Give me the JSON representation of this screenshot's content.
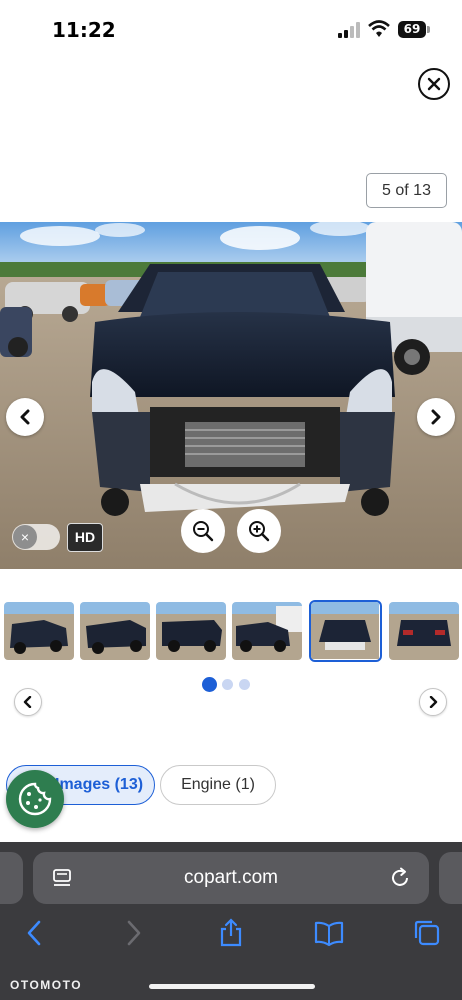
{
  "status_bar": {
    "time": "11:22",
    "battery": "69"
  },
  "viewer": {
    "counter": "5 of 13",
    "hd_label": "HD",
    "hd_toggle_symbol": "×"
  },
  "thumbnails": {
    "items": [
      {
        "name": "thumb-1",
        "active": false
      },
      {
        "name": "thumb-2",
        "active": false
      },
      {
        "name": "thumb-3",
        "active": false
      },
      {
        "name": "thumb-4",
        "active": false
      },
      {
        "name": "thumb-5",
        "active": true
      },
      {
        "name": "thumb-6",
        "active": false
      }
    ],
    "pages": 3,
    "current_page": 1
  },
  "filters": {
    "images_label": "Images (13)",
    "engine_label": "Engine",
    "engine_count": "(1)"
  },
  "browser": {
    "url": "copart.com"
  },
  "watermark": "OTOMOTO",
  "colors": {
    "accent": "#1d5fd6",
    "cookie": "#2e7d4f",
    "safari_bg": "#3b3b3e"
  }
}
